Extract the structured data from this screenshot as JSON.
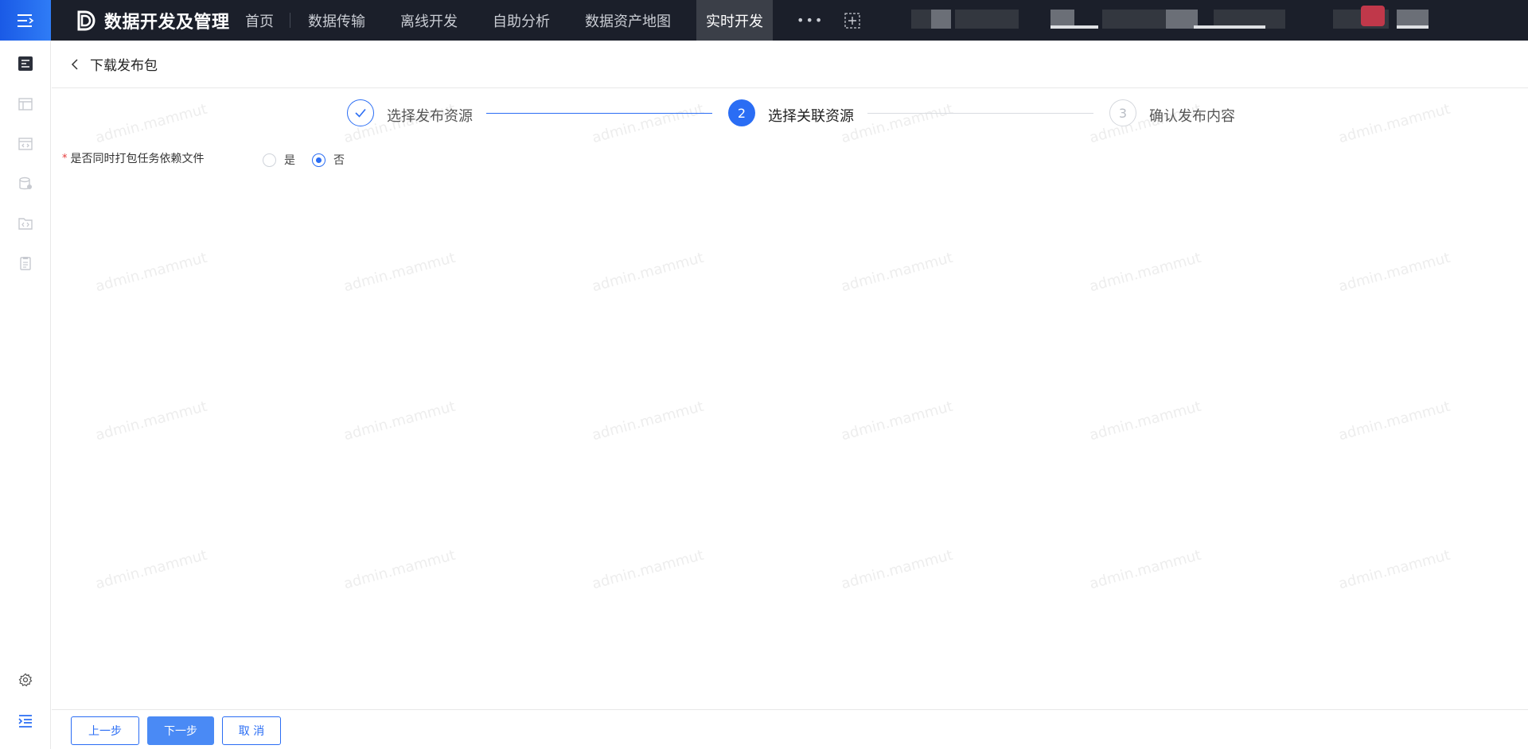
{
  "app": {
    "title": "数据开发及管理"
  },
  "nav": {
    "home": "首页",
    "items": [
      "数据传输",
      "离线开发",
      "自助分析",
      "数据资产地图"
    ],
    "active": "实时开发",
    "more": "•••"
  },
  "page": {
    "title": "下载发布包"
  },
  "steps": [
    {
      "number": "1",
      "label": "选择发布资源",
      "state": "done"
    },
    {
      "number": "2",
      "label": "选择关联资源",
      "state": "active"
    },
    {
      "number": "3",
      "label": "确认发布内容",
      "state": "wait"
    }
  ],
  "form": {
    "required_mark": "*",
    "label": "是否同时打包任务依赖文件",
    "options": [
      "是",
      "否"
    ],
    "selected": "否"
  },
  "watermark": "admin.mammut",
  "footer": {
    "prev": "上一步",
    "next": "下一步",
    "cancel": "取 消"
  },
  "colors": {
    "primary": "#2a6df4",
    "topbar": "#1b1f2a"
  }
}
